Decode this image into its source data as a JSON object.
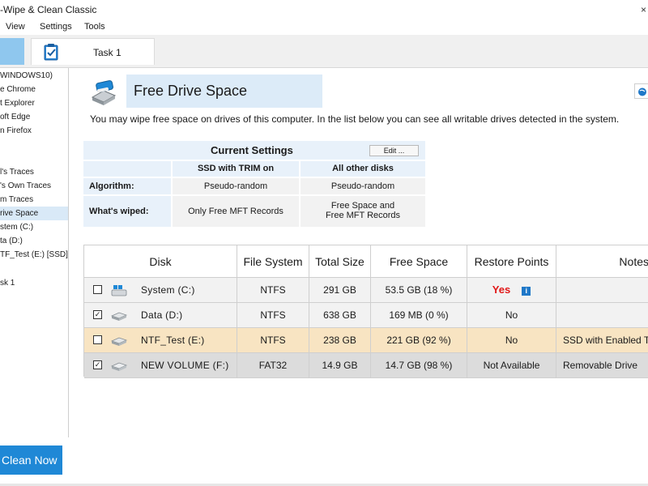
{
  "window": {
    "title": "-Wipe & Clean Classic",
    "close_glyph": "×"
  },
  "menu": [
    "View",
    "Settings",
    "Tools"
  ],
  "tabs": {
    "task_label": "Task 1"
  },
  "sidebar": {
    "items": [
      {
        "label": "WINDOWS10)"
      },
      {
        "label": "e Chrome"
      },
      {
        "label": "t  Explorer"
      },
      {
        "label": "oft Edge"
      },
      {
        "label": "n  Firefox"
      },
      {
        "label": ""
      },
      {
        "label": "l's Traces"
      },
      {
        "label": "'s Own Traces"
      },
      {
        "label": "m Traces"
      },
      {
        "label": "rive Space",
        "selected": true
      },
      {
        "label": "stem  (C:)"
      },
      {
        "label": "ta  (D:)"
      },
      {
        "label": "TF_Test  (E:) [SSD]"
      },
      {
        "label": ""
      },
      {
        "label": "sk 1"
      }
    ],
    "clean_button": "Clean Now"
  },
  "main": {
    "title": "Free Drive Space",
    "description": "You may wipe free space on drives of this computer. In the list below you can see all writable drives detected in the system."
  },
  "settings": {
    "title": "Current Settings",
    "edit_label": "Edit ...",
    "col_ssd": "SSD with TRIM on",
    "col_other": "All other disks",
    "row_algorithm": "Algorithm:",
    "algorithm_ssd": "Pseudo-random",
    "algorithm_other": "Pseudo-random",
    "row_wiped": "What's wiped:",
    "wiped_ssd": "Only Free MFT Records",
    "wiped_other_line1": "Free Space and",
    "wiped_other_line2": "Free MFT Records"
  },
  "disks": {
    "headers": [
      "Disk",
      "File System",
      "Total Size",
      "Free Space",
      "Restore Points",
      "Notes"
    ],
    "rows": [
      {
        "checked": false,
        "checkmark": "",
        "name": "System  (C:)",
        "fs": "NTFS",
        "total": "291 GB",
        "free": "53.5 GB  (18 %)",
        "restore": "Yes",
        "notes": "",
        "bg": "#f2f2f2",
        "icon": "windows-drive"
      },
      {
        "checked": true,
        "checkmark": "✓",
        "name": "Data  (D:)",
        "fs": "NTFS",
        "total": "638 GB",
        "free": "169 MB  (0 %)",
        "restore": "No",
        "notes": "",
        "bg": "#f2f2f2",
        "icon": "hard-drive"
      },
      {
        "checked": false,
        "checkmark": "",
        "name": "NTF_Test  (E:)",
        "fs": "NTFS",
        "total": "238 GB",
        "free": "221 GB  (92 %)",
        "restore": "No",
        "notes": "SSD with Enabled T",
        "bg": "#f8e4c2",
        "icon": "hard-drive"
      },
      {
        "checked": true,
        "checkmark": "✓",
        "name": "NEW VOLUME  (F:)",
        "fs": "FAT32",
        "total": "14.9 GB",
        "free": "14.7 GB  (98 %)",
        "restore": "Not Available",
        "notes": "Removable Drive",
        "bg": "#dcdcdc",
        "icon": "removable-drive"
      }
    ]
  },
  "colors": {
    "accent": "#1f88d6",
    "header_band": "#dcebf8",
    "yes_red": "#e11818"
  }
}
